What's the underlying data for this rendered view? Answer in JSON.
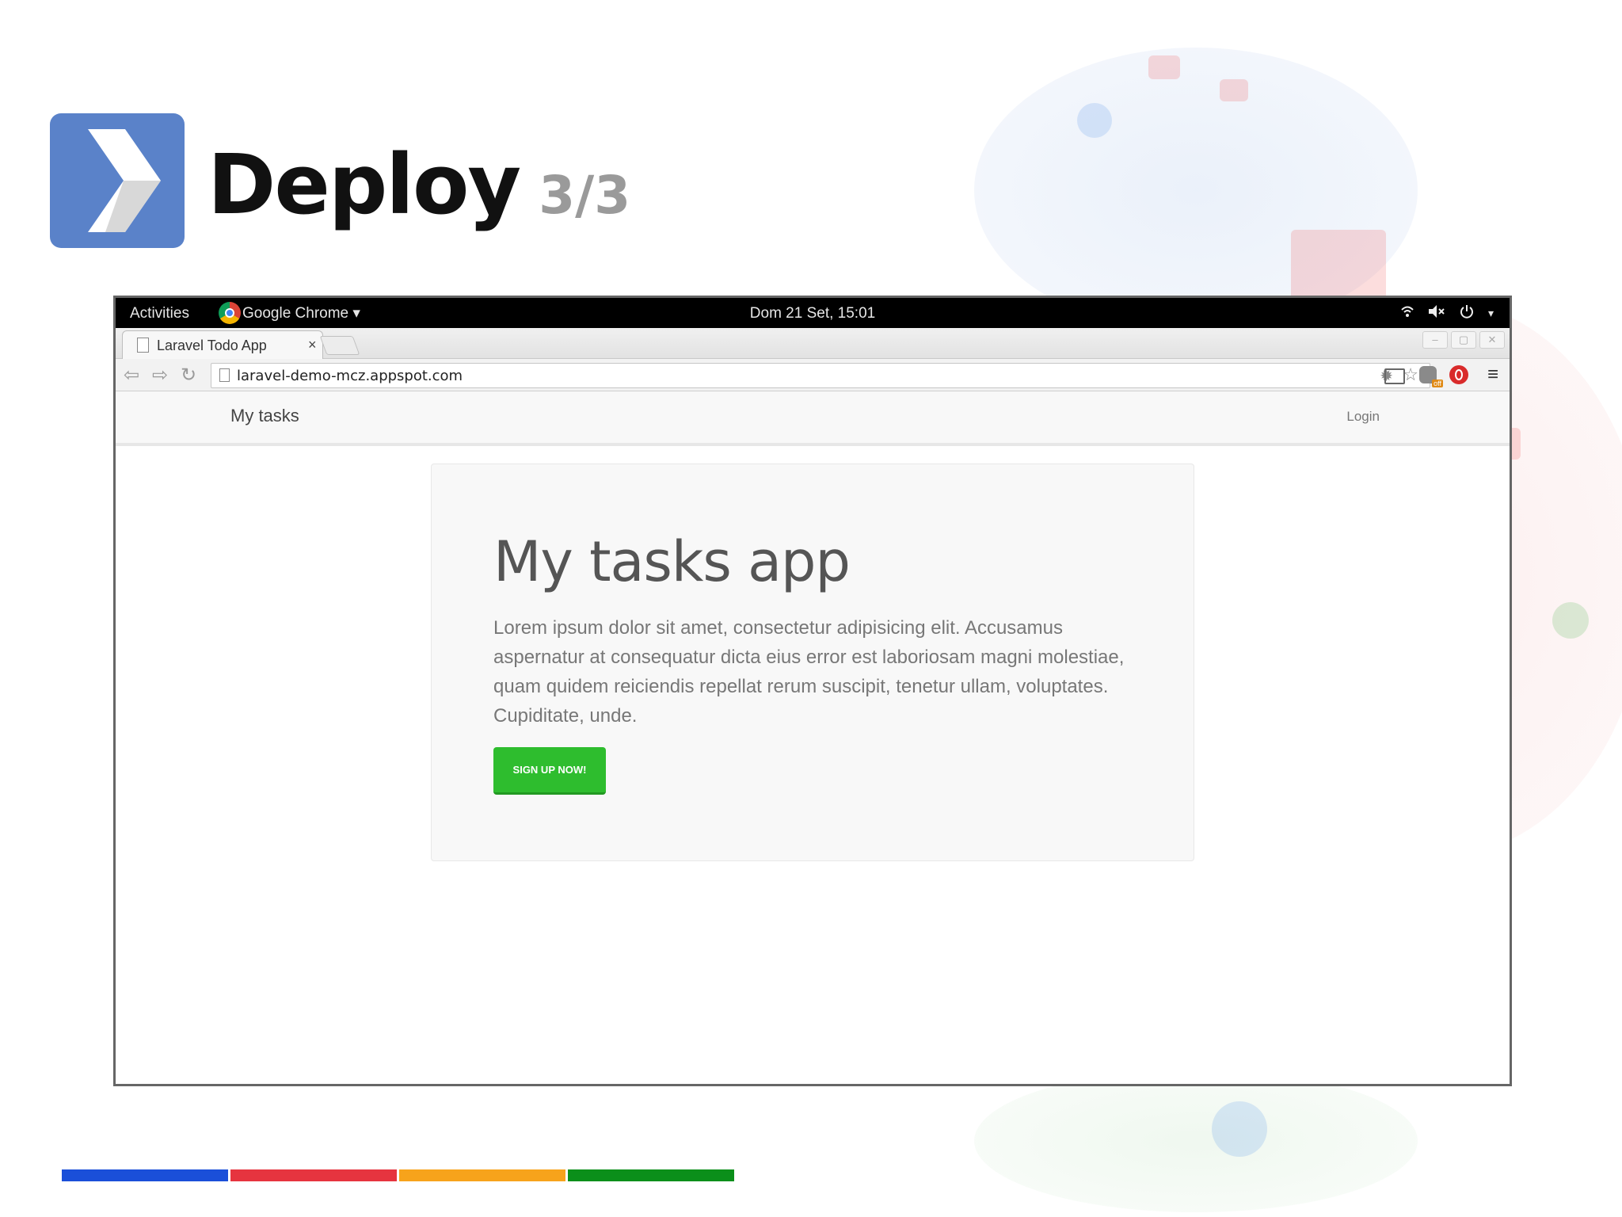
{
  "slide": {
    "title": "Deploy",
    "subtitle": "3/3",
    "footer_colors": [
      "#1a4fd9",
      "#e6343f",
      "#f7a31b",
      "#0b8f1a"
    ]
  },
  "desktop": {
    "activities": "Activities",
    "app_menu": "Google Chrome ▾",
    "clock": "Dom 21 Set, 15:01",
    "tray_icons": [
      "wifi-icon",
      "volume-muted-icon",
      "power-icon"
    ]
  },
  "browser": {
    "tab_title": "Laravel Todo App",
    "tab_close": "×",
    "url": "laravel-demo-mcz.appspot.com",
    "extension_badge": "off"
  },
  "page": {
    "brand": "My tasks",
    "login": "Login",
    "heading": "My tasks app",
    "lead": "Lorem ipsum dolor sit amet, consectetur adipisicing elit. Accusamus aspernatur at consequatur dicta eius error est laboriosam magni molestiae, quam quidem reiciendis repellat rerum suscipit, tenetur ullam, voluptates. Cupiditate, unde.",
    "cta": "SIGN UP NOW!",
    "cta_color": "#2ebd2e"
  }
}
